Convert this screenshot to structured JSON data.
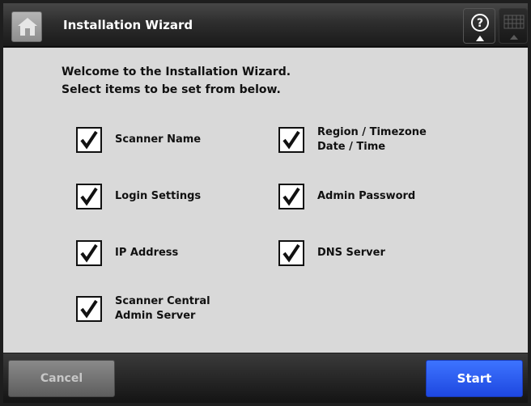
{
  "header": {
    "title": "Installation Wizard",
    "home_icon": "home-icon",
    "help_icon": "help-icon",
    "keyboard_icon": "keyboard-icon"
  },
  "welcome": {
    "line1": "Welcome to the Installation Wizard.",
    "line2": "Select items to be set from below."
  },
  "options": [
    {
      "label_lines": [
        "Scanner Name"
      ],
      "checked": true
    },
    {
      "label_lines": [
        "Region / Timezone",
        "Date / Time"
      ],
      "checked": true
    },
    {
      "label_lines": [
        "Login Settings"
      ],
      "checked": true
    },
    {
      "label_lines": [
        "Admin Password"
      ],
      "checked": true
    },
    {
      "label_lines": [
        "IP Address"
      ],
      "checked": true
    },
    {
      "label_lines": [
        "DNS Server"
      ],
      "checked": true
    },
    {
      "label_lines": [
        "Scanner Central",
        "Admin Server"
      ],
      "checked": true
    }
  ],
  "footer": {
    "cancel_label": "Cancel",
    "start_label": "Start"
  },
  "colors": {
    "accent": "#2a5cf5",
    "panel_bg": "#d9d9d9",
    "frame_bg": "#1e1e1e"
  }
}
